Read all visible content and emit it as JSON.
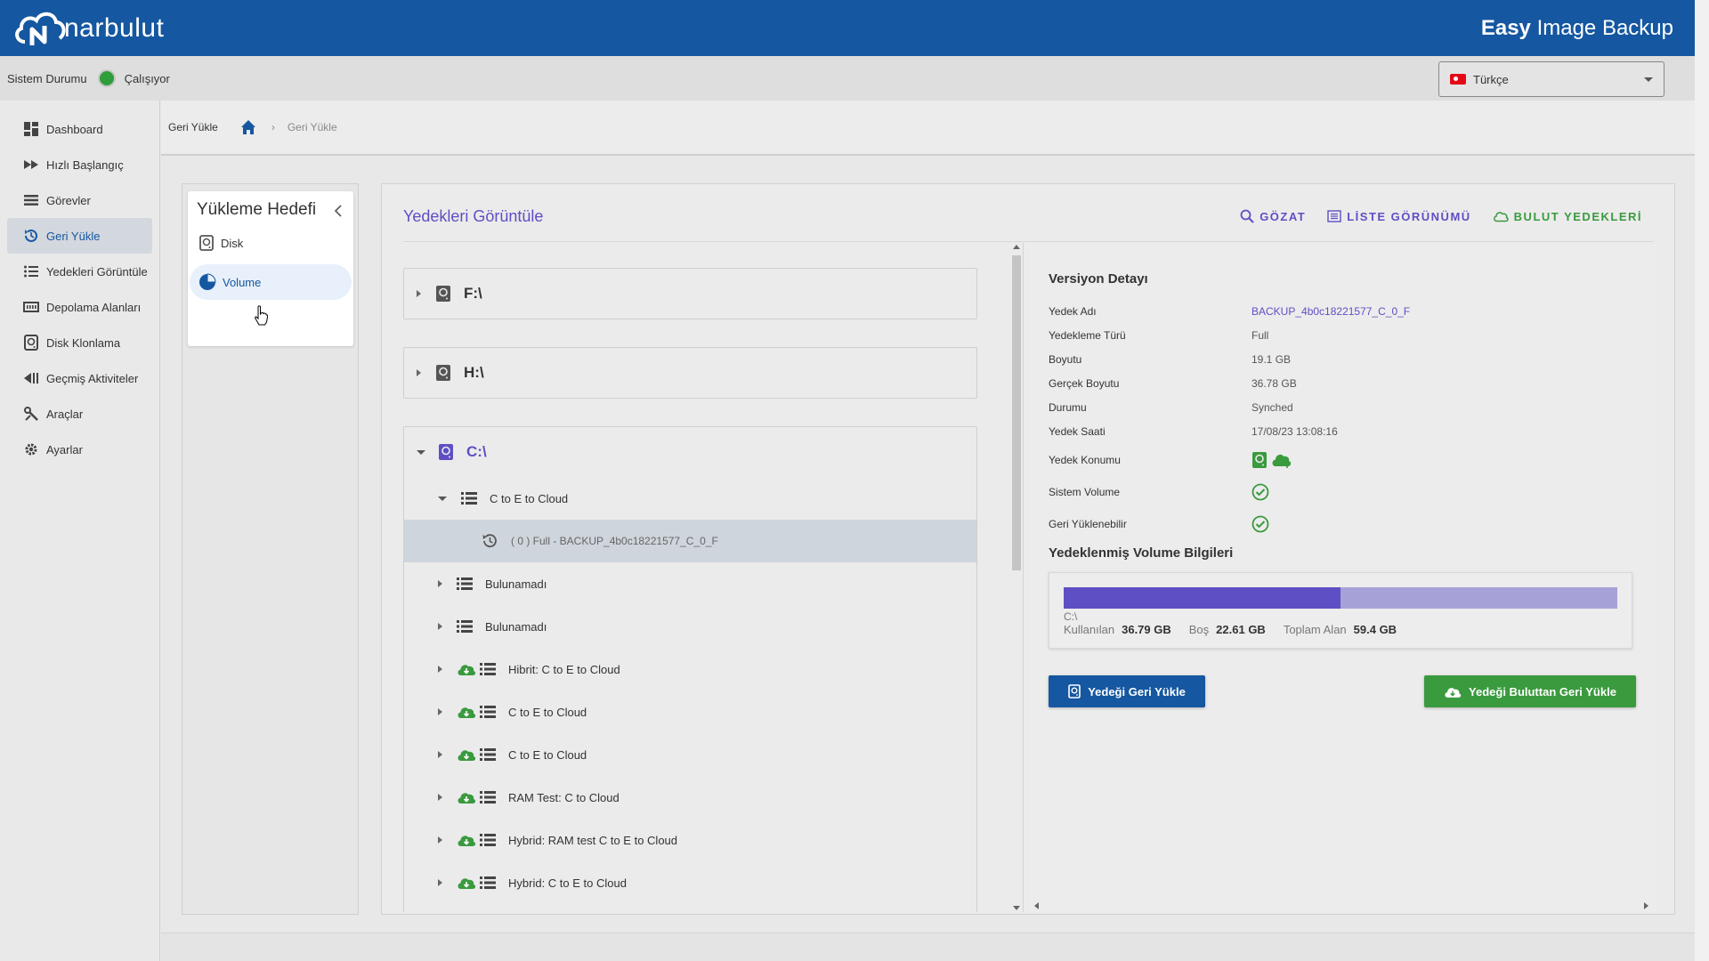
{
  "header": {
    "logo_text": "narbulut",
    "app_title_bold": "Easy",
    "app_title_rest": " Image Backup"
  },
  "status": {
    "label": "Sistem Durumu",
    "value": "Çalışıyor",
    "color": "#2e9d3a"
  },
  "language": {
    "selected": "Türkçe"
  },
  "sidebar": {
    "items": [
      {
        "label": "Dashboard",
        "icon": "dashboard-icon"
      },
      {
        "label": "Hızlı Başlangıç",
        "icon": "fast-forward-icon"
      },
      {
        "label": "Görevler",
        "icon": "list-icon"
      },
      {
        "label": "Geri Yükle",
        "icon": "restore-icon",
        "active": true
      },
      {
        "label": "Yedekleri Görüntüle",
        "icon": "list-view-icon"
      },
      {
        "label": "Depolama Alanları",
        "icon": "storage-icon"
      },
      {
        "label": "Disk Klonlama",
        "icon": "disk-icon"
      },
      {
        "label": "Geçmiş Aktiviteler",
        "icon": "history-icon"
      },
      {
        "label": "Araçlar",
        "icon": "tools-icon"
      },
      {
        "label": "Ayarlar",
        "icon": "gear-icon"
      }
    ]
  },
  "breadcrumb": {
    "root": "Geri Yükle",
    "current": "Geri Yükle"
  },
  "target": {
    "title": "Yükleme Hedefi",
    "items": [
      "Disk",
      "Volume"
    ],
    "selected": "Volume"
  },
  "main": {
    "title": "Yedekleri Görüntüle",
    "actions": {
      "browse": "GÖZAT",
      "list_view": "LİSTE GÖRÜNÜMÜ",
      "cloud": "BULUT YEDEKLERİ"
    },
    "drives": [
      {
        "label": "F:\\"
      },
      {
        "label": "H:\\"
      },
      {
        "label": "C:\\"
      }
    ],
    "rows": [
      {
        "label": "C to E to Cloud"
      },
      {
        "label": "( 0 ) Full - BACKUP_4b0c18221577_C_0_F"
      },
      {
        "label": "Bulunamadı"
      },
      {
        "label": "Bulunamadı"
      },
      {
        "label": "Hibrit: C to E to Cloud"
      },
      {
        "label": "C to E to Cloud"
      },
      {
        "label": "C to E to Cloud"
      },
      {
        "label": "RAM Test: C to Cloud"
      },
      {
        "label": "Hybrid: RAM test C to E to Cloud"
      },
      {
        "label": "Hybrid: C to E to Cloud"
      }
    ]
  },
  "detail": {
    "title": "Versiyon Detayı",
    "fields": [
      {
        "label": "Yedek Adı",
        "value": "BACKUP_4b0c18221577_C_0_F"
      },
      {
        "label": "Yedekleme Türü",
        "value": "Full"
      },
      {
        "label": "Boyutu",
        "value": "19.1 GB"
      },
      {
        "label": "Gerçek Boyutu",
        "value": "36.78 GB"
      },
      {
        "label": "Durumu",
        "value": "Synched"
      },
      {
        "label": "Yedek Saati",
        "value": "17/08/23 13:08:16"
      },
      {
        "label": "Yedek Konumu",
        "value": ""
      },
      {
        "label": "Sistem Volume",
        "value": ""
      },
      {
        "label": "Geri Yüklenebilir",
        "value": ""
      }
    ],
    "volume": {
      "title": "Yedeklenmiş Volume Bilgileri",
      "name": "C:\\",
      "used_label": "Kullanılan",
      "used": "36.79 GB",
      "free_label": "Boş",
      "free": "22.61 GB",
      "total_label": "Toplam Alan",
      "total": "59.4 GB",
      "used_fraction": 0.5
    },
    "buttons": {
      "restore": "Yedeği Geri Yükle",
      "restore_cloud": "Yedeği Buluttan Geri Yükle"
    }
  },
  "colors": {
    "brand": "#1557a0",
    "accent": "#5e4fc4",
    "success": "#3a9a3e"
  }
}
